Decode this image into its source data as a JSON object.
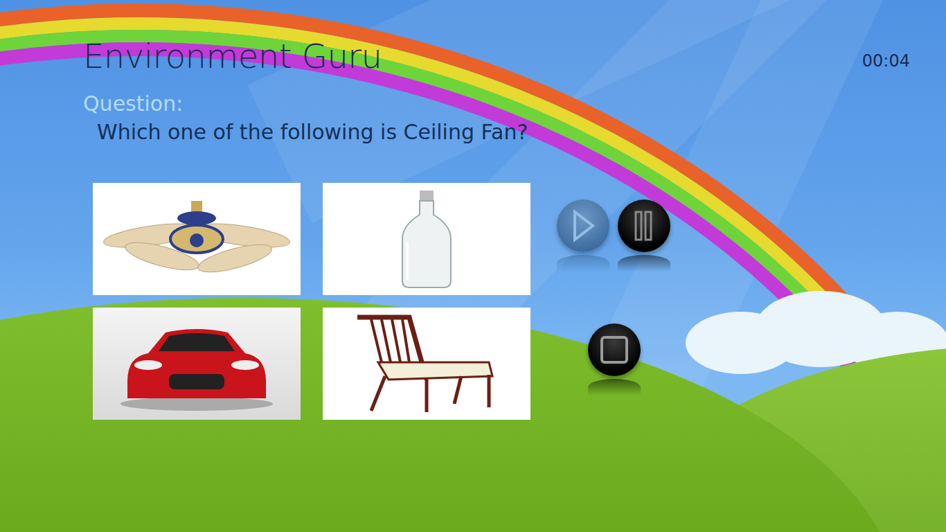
{
  "app": {
    "title": "Environment Guru",
    "timer": "00:04"
  },
  "question": {
    "label": "Question:",
    "text": "Which one of the following is Ceiling Fan?"
  },
  "options": [
    {
      "kind": "fan"
    },
    {
      "kind": "bottle"
    },
    {
      "kind": "car"
    },
    {
      "kind": "chair"
    }
  ],
  "controls": [
    {
      "kind": "play",
      "disabled": true
    },
    {
      "kind": "pause",
      "disabled": false
    },
    {
      "kind": "stop",
      "disabled": false
    }
  ]
}
